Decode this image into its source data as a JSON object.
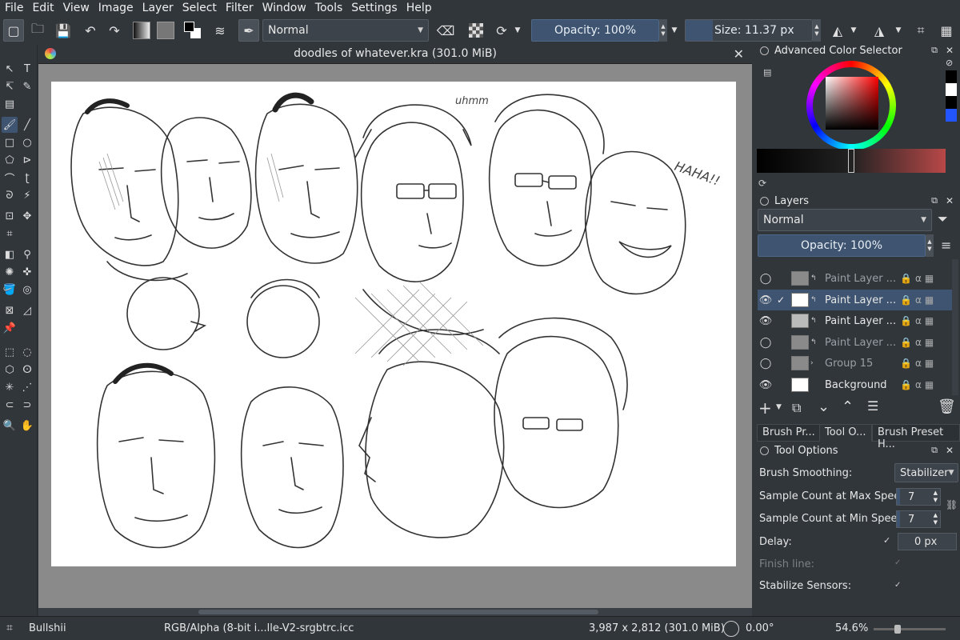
{
  "menu": [
    "File",
    "Edit",
    "View",
    "Image",
    "Layer",
    "Select",
    "Filter",
    "Window",
    "Tools",
    "Settings",
    "Help"
  ],
  "toolbar": {
    "blend_mode": "Normal",
    "opacity": "Opacity: 100%",
    "size": "Size: 11.37 px"
  },
  "document": {
    "title": "doodles of whatever.kra (301.0 MiB)"
  },
  "color_selector": {
    "title": "Advanced Color Selector",
    "colors": {
      "selected_red": "#cc2a2a",
      "swatch_blue": "#2255ff"
    }
  },
  "layers": {
    "title": "Layers",
    "blend_mode": "Normal",
    "opacity": "Opacity: 100%",
    "items": [
      {
        "name": "Paint Layer ...",
        "visible": false,
        "selected": false,
        "dim": true
      },
      {
        "name": "Paint Layer ...",
        "visible": true,
        "selected": true,
        "dim": false
      },
      {
        "name": "Paint Layer ...",
        "visible": true,
        "selected": false,
        "dim": false
      },
      {
        "name": "Paint Layer ...",
        "visible": false,
        "selected": false,
        "dim": true
      },
      {
        "name": "Group 15",
        "visible": false,
        "selected": false,
        "dim": true
      },
      {
        "name": "Background",
        "visible": true,
        "selected": false,
        "dim": false
      }
    ]
  },
  "tabs": [
    "Brush Pr...",
    "Tool O...",
    "Brush Preset H..."
  ],
  "tool_options": {
    "title": "Tool Options",
    "brush_smoothing_label": "Brush Smoothing:",
    "brush_smoothing_value": "Stabilizer",
    "sample_max_label": "Sample Count at Max Speed:",
    "sample_max_value": "7",
    "sample_min_label": "Sample Count at Min Speed:",
    "sample_min_value": "7",
    "delay_label": "Delay:",
    "delay_value": "0 px",
    "finish_line_label": "Finish line:",
    "stabilize_label": "Stabilize Sensors:"
  },
  "status": {
    "brush": "Bullshii",
    "color_profile": "RGB/Alpha (8-bit i...lle-V2-srgbtrc.icc",
    "dimensions": "3,987 x 2,812 (301.0 MiB)",
    "rotation": "0.00°",
    "zoom": "54.6%"
  },
  "canvas": {
    "annotations": [
      "uhmm",
      "HAHA!!"
    ]
  }
}
